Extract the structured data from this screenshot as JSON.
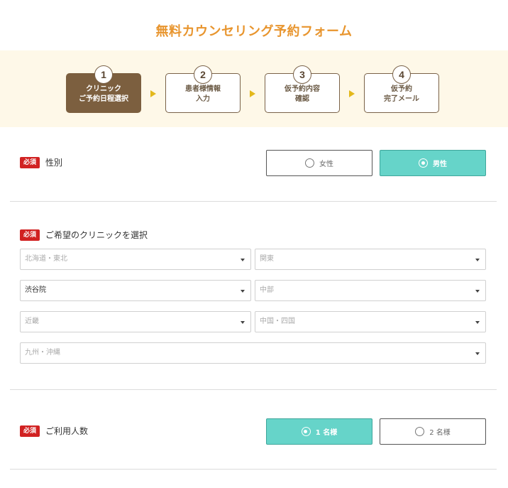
{
  "page": {
    "title": "無料カウンセリング予約フォーム"
  },
  "steps": [
    {
      "num": "1",
      "label": "クリニック\nご予約日程選択",
      "active": true
    },
    {
      "num": "2",
      "label": "患者様情報\n入力",
      "active": false
    },
    {
      "num": "3",
      "label": "仮予約内容\n確認",
      "active": false
    },
    {
      "num": "4",
      "label": "仮予約\n完了メール",
      "active": false
    }
  ],
  "required_badge": "必須",
  "gender": {
    "label": "性別",
    "options": [
      {
        "label": "女性",
        "checked": false
      },
      {
        "label": "男性",
        "checked": true
      }
    ]
  },
  "clinic": {
    "label": "ご希望のクリニックを選択",
    "selects": [
      {
        "value": "北海道・東北",
        "filled": false
      },
      {
        "value": "関東",
        "filled": false
      },
      {
        "value": "渋谷院",
        "filled": true
      },
      {
        "value": "中部",
        "filled": false
      },
      {
        "value": "近畿",
        "filled": false
      },
      {
        "value": "中国・四国",
        "filled": false
      },
      {
        "value": "九州・沖縄",
        "filled": false
      }
    ]
  },
  "people": {
    "label": "ご利用人数",
    "options": [
      {
        "label": "1 名様",
        "checked": true
      },
      {
        "label": "2 名様",
        "checked": false
      }
    ]
  },
  "colors": {
    "title": "#e8952e",
    "step_active": "#7c5f3f",
    "accent": "#66d4c9",
    "required": "#d12222",
    "arrow": "#e3b81c",
    "band": "#fef8e8"
  }
}
